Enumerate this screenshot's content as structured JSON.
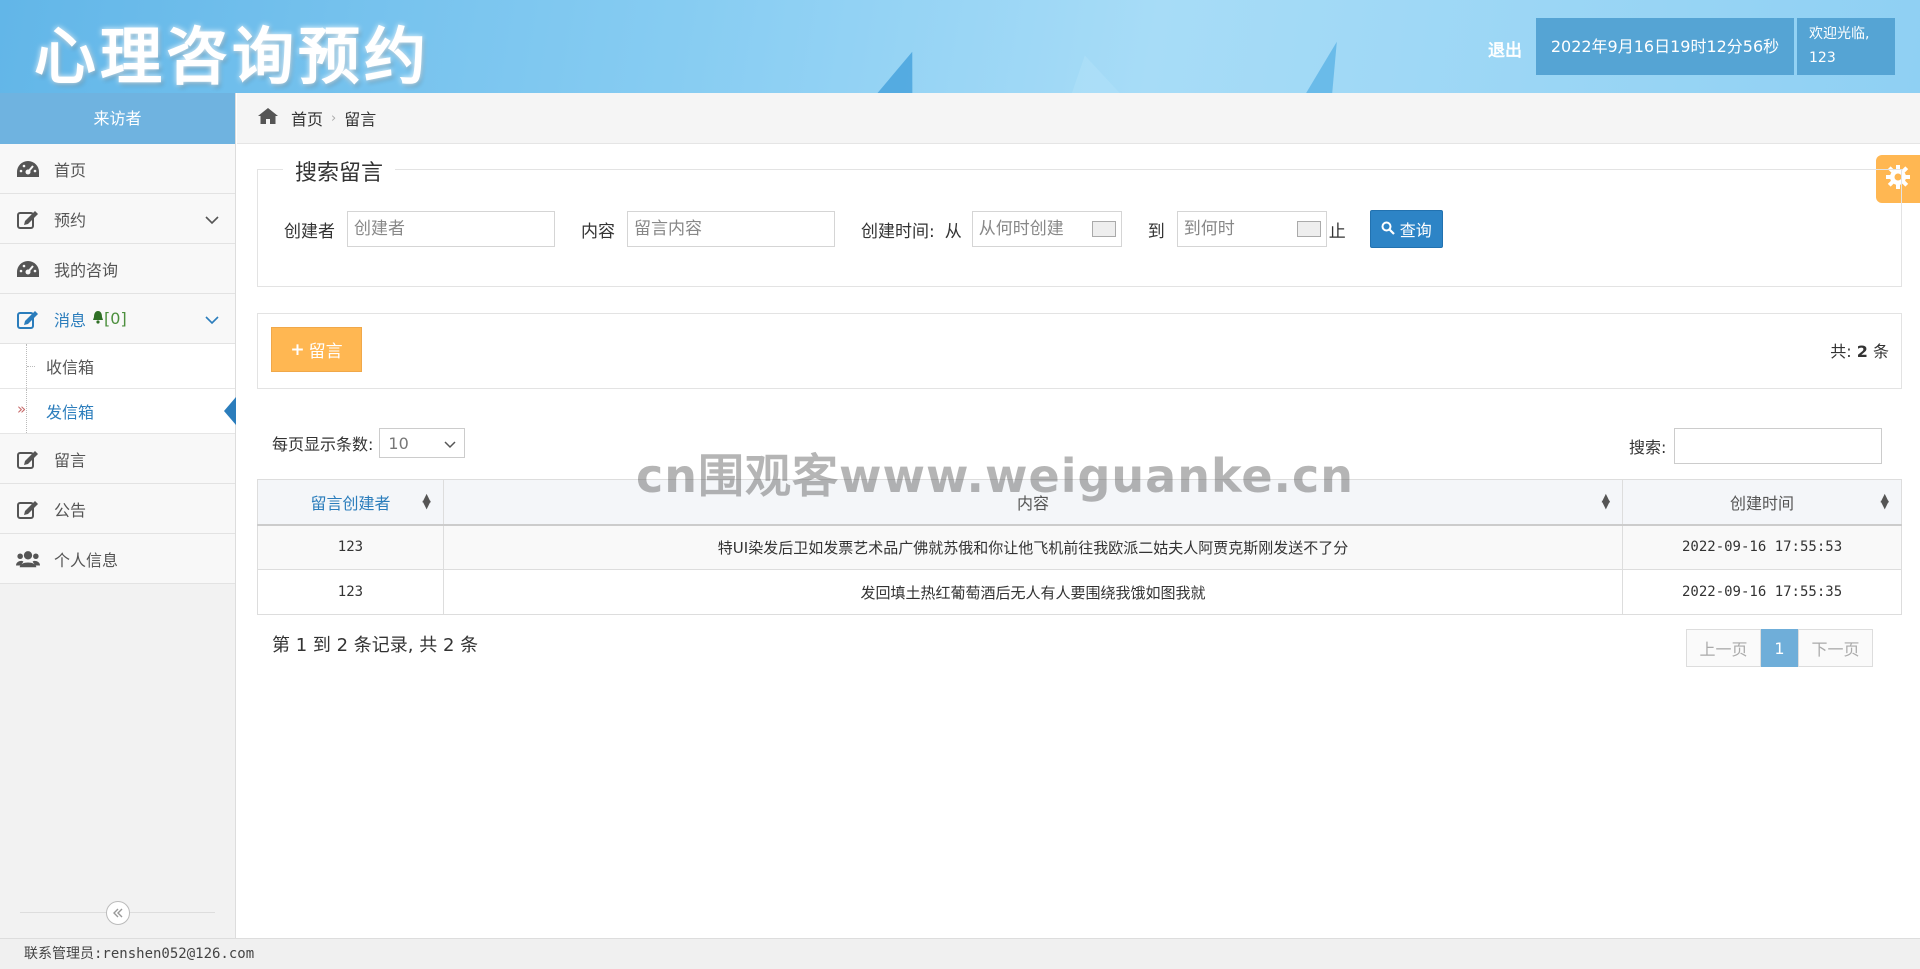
{
  "header": {
    "logo_text": "心理咨询预约",
    "logout_label": "退出",
    "clock_text": "2022年9月16日19时12分56秒",
    "welcome_line1": "欢迎光临,",
    "welcome_line2": "123"
  },
  "sidebar": {
    "title": "来访者",
    "items": [
      {
        "label": "首页",
        "icon": "dashboard-icon"
      },
      {
        "label": "预约",
        "icon": "edit-icon"
      },
      {
        "label": "我的咨询",
        "icon": "dashboard-icon"
      },
      {
        "label": "消息",
        "icon": "edit-icon",
        "badge": "[0]"
      },
      {
        "label": "留言",
        "icon": "edit-icon"
      },
      {
        "label": "公告",
        "icon": "edit-icon"
      },
      {
        "label": "个人信息",
        "icon": "users-icon"
      }
    ],
    "sub_items": [
      {
        "label": "收信箱"
      },
      {
        "label": "发信箱"
      }
    ]
  },
  "breadcrumb": {
    "home": "首页",
    "current": "留言"
  },
  "search": {
    "legend": "搜索留言",
    "creator_label": "创建者",
    "creator_placeholder": "创建者",
    "content_label": "内容",
    "content_placeholder": "留言内容",
    "time_label": "创建时间:",
    "from_label": "从",
    "from_placeholder": "从何时创建",
    "to_label": "到",
    "to_placeholder": "到何时",
    "end_label": "止",
    "query_label": "查询"
  },
  "toolbar": {
    "add_label": "留言",
    "total_prefix": "共:",
    "total_count": "2",
    "total_suffix": "条"
  },
  "table_controls": {
    "length_label": "每页显示条数:",
    "length_value": "10",
    "search_label": "搜索:"
  },
  "watermark": "cn围观客www.weiguanke.cn",
  "table": {
    "headers": [
      "留言创建者",
      "内容",
      "创建时间"
    ],
    "rows": [
      [
        "123",
        "特UI染发后卫如发票艺术品广佛就苏俄和你让他飞机前往我欧派二姑夫人阿贾克斯刚发送不了分",
        "2022-09-16 17:55:53"
      ],
      [
        "123",
        "发回填土热红葡萄酒后无人有人要围绕我饿如图我就",
        "2022-09-16 17:55:35"
      ]
    ]
  },
  "pagination": {
    "info": "第 1 到 2 条记录, 共 2 条",
    "prev_label": "上一页",
    "current_page": "1",
    "next_label": "下一页"
  },
  "footer": {
    "text": "联系管理员:renshen052@126.com"
  }
}
